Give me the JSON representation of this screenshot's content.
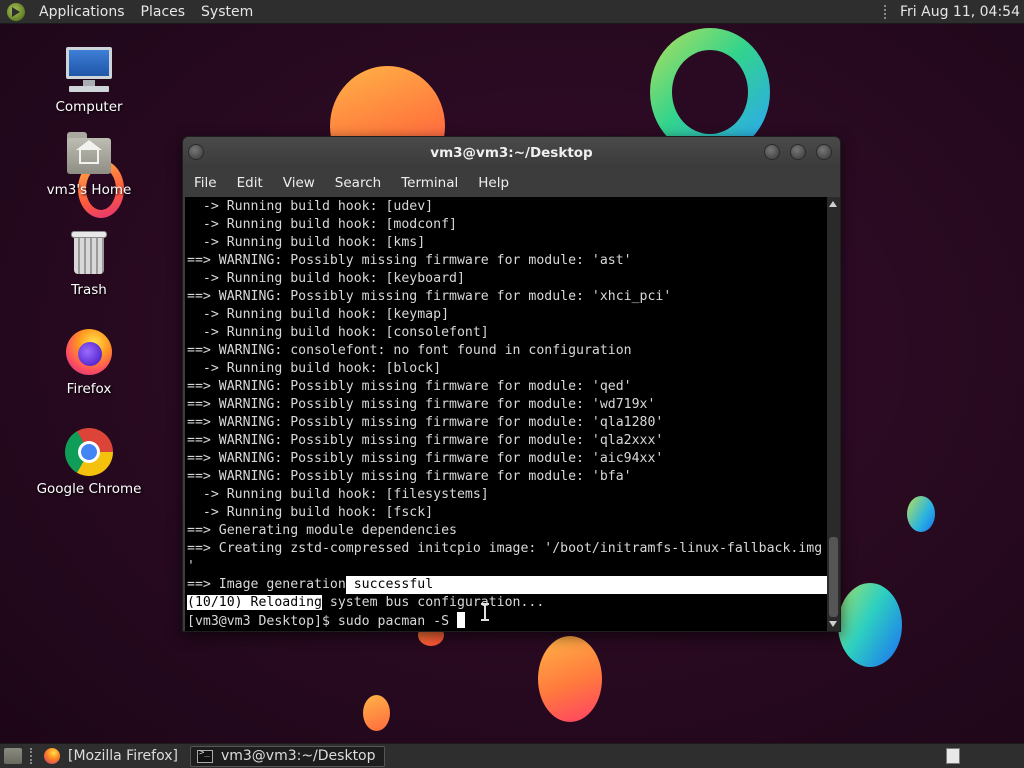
{
  "top_panel": {
    "menus": [
      "Applications",
      "Places",
      "System"
    ],
    "clock": "Fri Aug 11, 04:54"
  },
  "desktop": {
    "icons": [
      {
        "label": "Computer",
        "icon": "computer-icon"
      },
      {
        "label": "vm3's Home",
        "icon": "home-folder-icon"
      },
      {
        "label": "Trash",
        "icon": "trash-icon"
      },
      {
        "label": "Firefox",
        "icon": "firefox-icon"
      },
      {
        "label": "Google Chrome",
        "icon": "chrome-icon"
      }
    ]
  },
  "terminal": {
    "title": "vm3@vm3:~/Desktop",
    "menus": [
      "File",
      "Edit",
      "View",
      "Search",
      "Terminal",
      "Help"
    ],
    "lines": [
      "  -> Running build hook: [udev]",
      "  -> Running build hook: [modconf]",
      "  -> Running build hook: [kms]",
      "==> WARNING: Possibly missing firmware for module: 'ast'",
      "  -> Running build hook: [keyboard]",
      "==> WARNING: Possibly missing firmware for module: 'xhci_pci'",
      "  -> Running build hook: [keymap]",
      "  -> Running build hook: [consolefont]",
      "==> WARNING: consolefont: no font found in configuration",
      "  -> Running build hook: [block]",
      "==> WARNING: Possibly missing firmware for module: 'qed'",
      "==> WARNING: Possibly missing firmware for module: 'wd719x'",
      "==> WARNING: Possibly missing firmware for module: 'qla1280'",
      "==> WARNING: Possibly missing firmware for module: 'qla2xxx'",
      "==> WARNING: Possibly missing firmware for module: 'aic94xx'",
      "==> WARNING: Possibly missing firmware for module: 'bfa'",
      "  -> Running build hook: [filesystems]",
      "  -> Running build hook: [fsck]",
      "==> Generating module dependencies",
      "==> Creating zstd-compressed initcpio image: '/boot/initramfs-linux-fallback.img",
      "'"
    ],
    "line_image_success_a": "==> Image generation",
    "line_image_success_b": " successful",
    "line_reload_a": "(10/10) Reloading",
    "line_reload_b": " system bus configuration...",
    "prompt": "[vm3@vm3 Desktop]$ sudo pacman -S "
  },
  "taskbar": {
    "tasks": [
      {
        "label": "[Mozilla Firefox]",
        "icon": "firefox-icon",
        "active": false
      },
      {
        "label": "vm3@vm3:~/Desktop",
        "icon": "terminal-icon",
        "active": true
      }
    ]
  }
}
